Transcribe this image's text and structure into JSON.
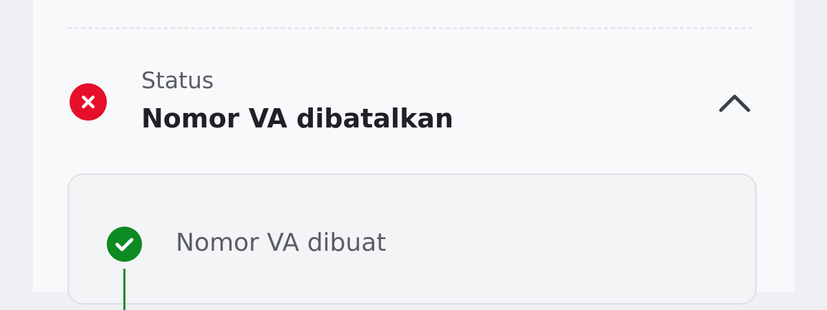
{
  "status": {
    "label": "Status",
    "value": "Nomor VA dibatalkan",
    "icon": "close-icon",
    "icon_color": "#e60f2a",
    "toggle_icon": "chevron-up-icon",
    "expanded": true
  },
  "timeline": {
    "steps": [
      {
        "label": "Nomor VA dibuat",
        "icon": "check-icon",
        "state": "done",
        "color": "#0d8a21"
      }
    ]
  }
}
